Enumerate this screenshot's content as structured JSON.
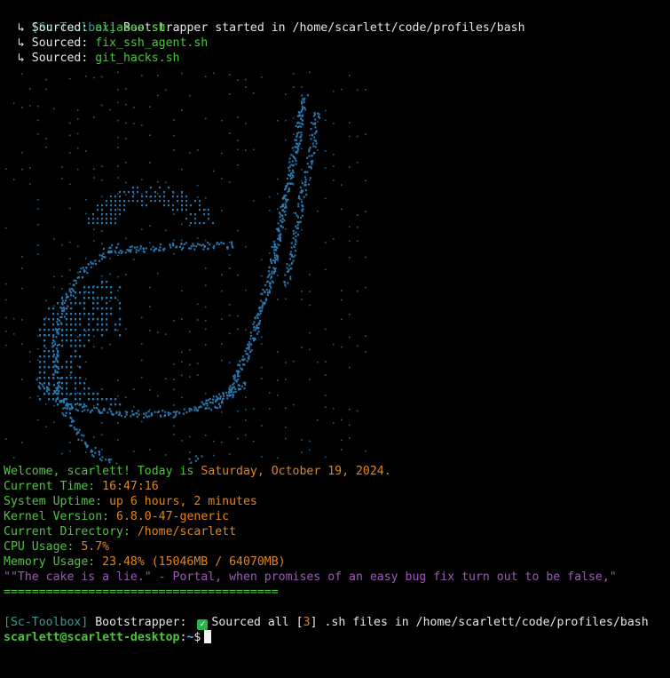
{
  "header": {
    "prefix": "[Sc-Toolbox]",
    "message": " Bootstrapper started in /home/scarlett/code/profiles/bash"
  },
  "sourced": [
    {
      "label": "  ↳ Sourced: ",
      "file": "aliases.sh"
    },
    {
      "label": "  ↳ Sourced: ",
      "file": "fix_ssh_agent.sh"
    },
    {
      "label": "  ↳ Sourced: ",
      "file": "git_hacks.sh"
    }
  ],
  "art": {
    "icon": "portal-aperture-ascii-art",
    "color": "#2a7db8"
  },
  "welcome": {
    "prefix": "Welcome, scarlett! Today is ",
    "date": "Saturday, October 19, 2024."
  },
  "info": [
    {
      "label": "Current Time: ",
      "value": "16:47:16"
    },
    {
      "label": "System Uptime: ",
      "value": "up 6 hours, 2 minutes"
    },
    {
      "label": "Kernel Version: ",
      "value": "6.8.0-47-generic"
    },
    {
      "label": "Current Directory: ",
      "value": "/home/scarlett"
    },
    {
      "label": "CPU Usage: ",
      "value": "5.7%"
    },
    {
      "label": "Memory Usage: ",
      "value": "23.48% (15046MB / 64070MB)"
    }
  ],
  "quote": "\"\"The cake is a lie.\" - Portal, when promises of an easy bug fix turn out to be false,\"",
  "separator": "=======================================",
  "footer": {
    "prefix": "[Sc-Toolbox]",
    "pre": " Bootstrapper: ",
    "check_icon": "check-icon",
    "sourced_text": "Sourced all ",
    "bracket_open": "[",
    "count": "3",
    "bracket_close": "]",
    "rest": " .sh files in /home/scarlett/code/profiles/bash"
  },
  "prompt": {
    "user_host": "scarlett@scarlett-desktop",
    "colon": ":",
    "path": "~",
    "symbol": "$"
  },
  "colors": {
    "teal": "#2aa198",
    "green": "#4fc43f",
    "orange": "#e0861f",
    "purple": "#9b59b6",
    "prompt_blue": "#5aa6ff"
  }
}
